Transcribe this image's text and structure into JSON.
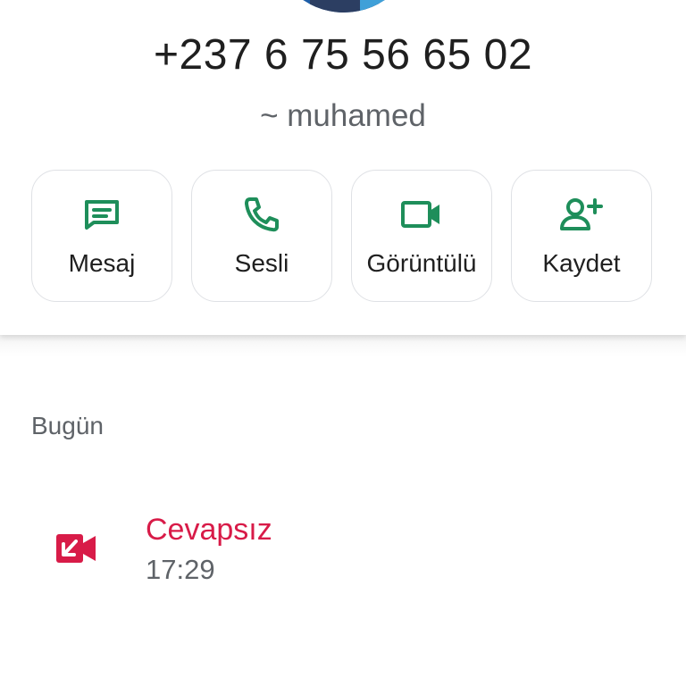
{
  "contact": {
    "phone_number": "+237 6 75 56 65 02",
    "name": "~ muhamed"
  },
  "actions": [
    {
      "label": "Mesaj",
      "icon": "message-icon"
    },
    {
      "label": "Sesli",
      "icon": "phone-icon"
    },
    {
      "label": "Görüntülü",
      "icon": "video-camera-icon"
    },
    {
      "label": "Kaydet",
      "icon": "add-contact-icon"
    }
  ],
  "history": {
    "section_label": "Bugün",
    "calls": [
      {
        "status": "Cevapsız",
        "time": "17:29",
        "icon": "missed-video-call-icon"
      }
    ]
  },
  "colors": {
    "accent_green": "#1e8e5a",
    "missed_red": "#d81b48",
    "text_primary": "#1f1f1f",
    "text_secondary": "#5f6368"
  }
}
